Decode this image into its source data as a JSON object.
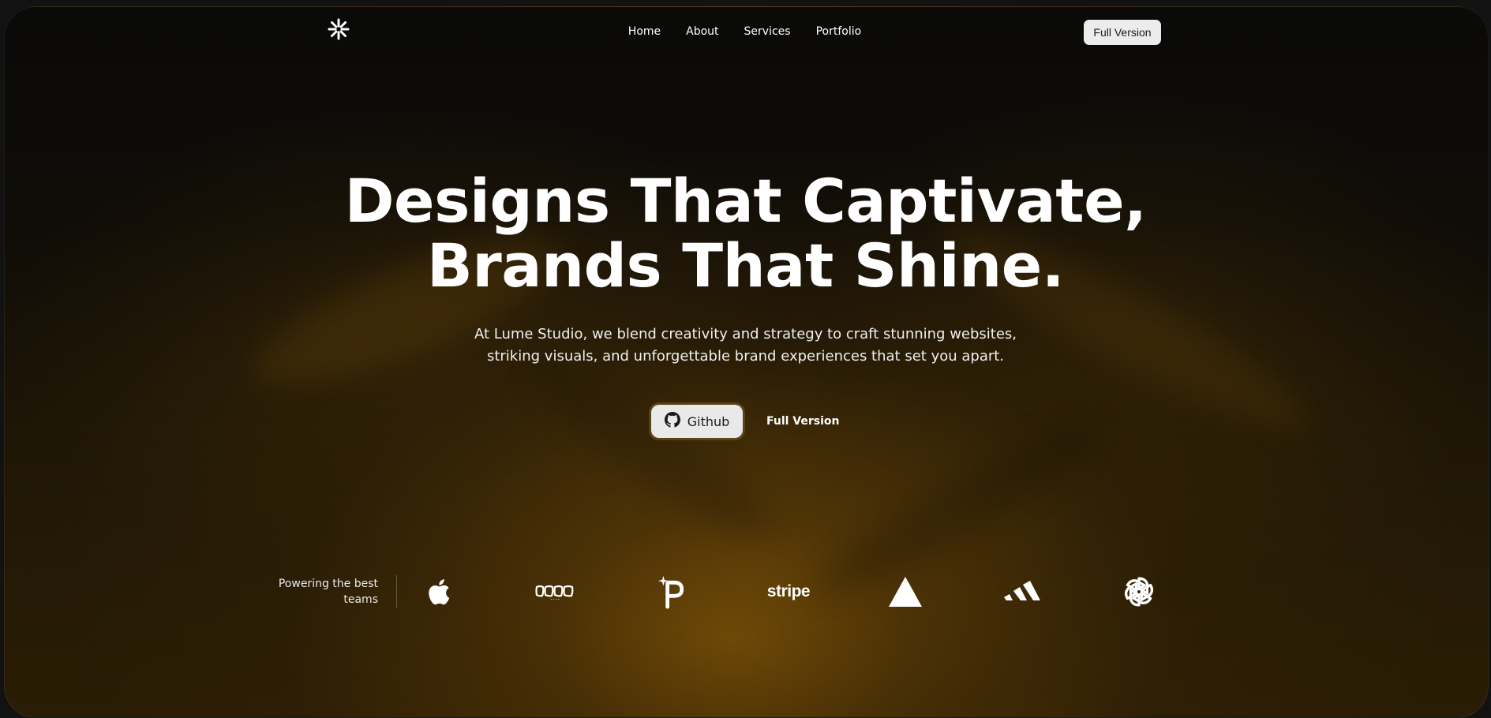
{
  "nav": {
    "logo_icon": "sparkle-burst-icon",
    "links": [
      {
        "label": "Home"
      },
      {
        "label": "About"
      },
      {
        "label": "Services"
      },
      {
        "label": "Portfolio"
      }
    ],
    "cta_label": "Full Version"
  },
  "hero": {
    "headline_line1": "Designs That Captivate,",
    "headline_line2": "Brands That Shine.",
    "subtitle_line1": "At Lume Studio, we blend creativity and strategy to craft stunning websites,",
    "subtitle_line2": "striking visuals, and unforgettable brand experiences that set you apart.",
    "github_label": "Github",
    "github_icon": "github-icon",
    "full_version_label": "Full Version"
  },
  "clients": {
    "caption_line1": "Powering the best",
    "caption_line2": "teams",
    "logos": [
      {
        "icon": "apple-logo-icon"
      },
      {
        "icon": "wordmark-logo-icon"
      },
      {
        "icon": "p-sparkle-logo-icon"
      },
      {
        "icon": "stripe-logo-icon",
        "text": "stripe"
      },
      {
        "icon": "triangle-logo-icon"
      },
      {
        "icon": "adidas-logo-icon"
      },
      {
        "icon": "openai-logo-icon"
      }
    ]
  },
  "colors": {
    "background": "#121212",
    "accent_glow": "#966208",
    "button_bg": "#ececec",
    "text": "#ffffff"
  }
}
